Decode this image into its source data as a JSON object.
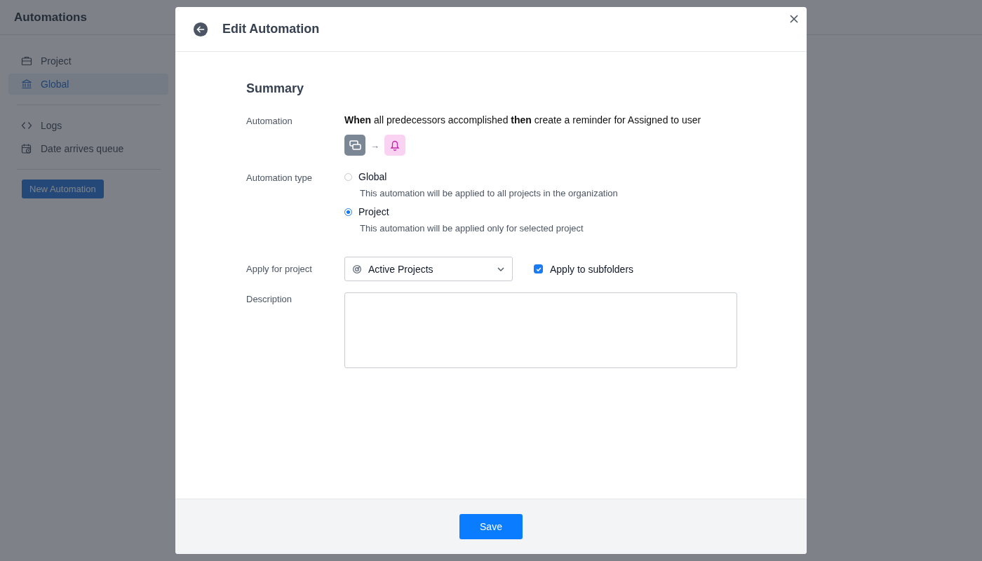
{
  "page": {
    "title": "Automations",
    "sidebar_groups": [
      [
        {
          "label": "Project",
          "selected": false
        },
        {
          "label": "Global",
          "selected": true
        }
      ],
      [
        {
          "label": "Logs",
          "selected": false
        },
        {
          "label": "Date arrives queue",
          "selected": false
        }
      ]
    ],
    "new_button": "New Automation"
  },
  "modal": {
    "title": "Edit Automation",
    "heading": "Summary",
    "automation": {
      "label": "Automation",
      "sentence": "**When** all predecessors accomplished **then** create a reminder for Assigned to user",
      "arrow": "→"
    },
    "automation_type": {
      "label": "Automation type",
      "options": [
        {
          "label": "Global",
          "description": "This automation will be applied to all projects in the organization",
          "selected": false
        },
        {
          "label": "Project",
          "description": "This automation will be applied only for selected project",
          "selected": true
        }
      ]
    },
    "apply_for_project": {
      "label": "Apply for project",
      "value": "Active Projects",
      "checkbox": {
        "label": "Apply to subfolders",
        "checked": true
      }
    },
    "description": {
      "label": "Description"
    },
    "save": "Save"
  }
}
